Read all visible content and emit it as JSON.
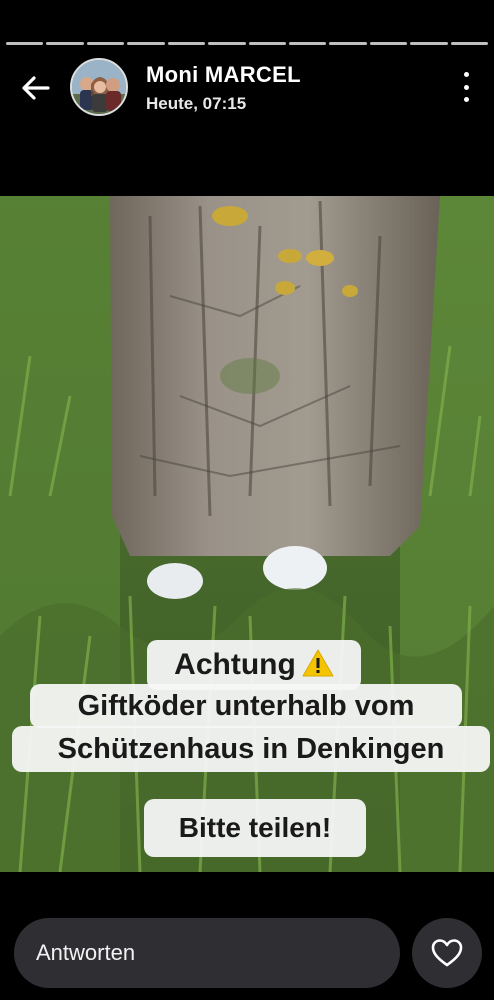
{
  "story": {
    "segments_total": 12,
    "author_name": "Moni MARCEL",
    "timestamp": "Heute, 07:15"
  },
  "caption": {
    "line1": "Achtung",
    "line2": "Giftköder unterhalb vom",
    "line3": "Schützenhaus in Denkingen",
    "line4": "Bitte teilen!"
  },
  "footer": {
    "reply_placeholder": "Antworten"
  },
  "icons": {
    "back": "arrow-left-icon",
    "menu": "more-vertical-icon",
    "warning": "warning-triangle-icon",
    "like": "heart-icon"
  },
  "colors": {
    "background": "#000000",
    "reply_field": "#2f2f33",
    "caption_bg": "#f5f5f5",
    "warning": "#f5c400"
  }
}
